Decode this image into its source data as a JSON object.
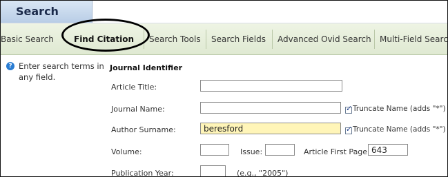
{
  "header": {
    "title": "Search"
  },
  "tabs": [
    {
      "label": "Basic Search"
    },
    {
      "label": "Find Citation"
    },
    {
      "label": "Search Tools"
    },
    {
      "label": "Search Fields"
    },
    {
      "label": "Advanced Ovid Search"
    },
    {
      "label": "Multi-Field Searc"
    }
  ],
  "help": {
    "text": "Enter search terms in any field."
  },
  "form": {
    "section_title": "Journal Identifier",
    "article_title": {
      "label": "Article Title:",
      "value": ""
    },
    "journal_name": {
      "label": "Journal Name:",
      "value": "",
      "truncate_label": "Truncate Name (adds \"*\")"
    },
    "author_surname": {
      "label": "Author Surname:",
      "value": "beresford",
      "truncate_label": "Truncate Name (adds \"*\")"
    },
    "volume": {
      "label": "Volume:",
      "value": ""
    },
    "issue": {
      "label": "Issue:",
      "value": ""
    },
    "first_page": {
      "label": "Article First Page:",
      "value": "643"
    },
    "publication_year": {
      "label": "Publication Year:",
      "value": "",
      "hint": "(e.g., \"2005\")"
    }
  }
}
